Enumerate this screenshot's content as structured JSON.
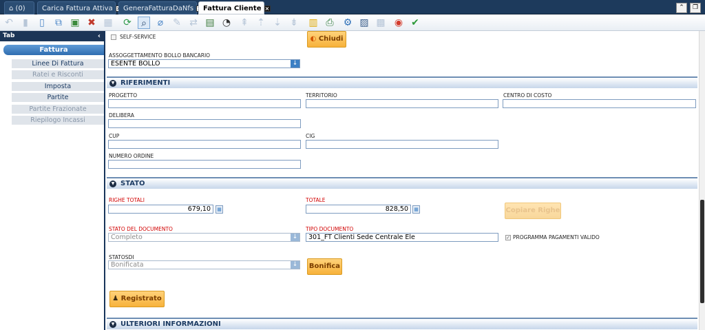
{
  "tabs": [
    {
      "label": "(0)"
    },
    {
      "label": "Carica Fattura Attiva"
    },
    {
      "label": "GeneraFatturaDaNfs"
    },
    {
      "label": "Fattura Cliente"
    }
  ],
  "sidebar": {
    "header": "Tab",
    "active_tab": "Fattura",
    "items": [
      {
        "label": "Linee Di Fattura",
        "enabled": true
      },
      {
        "label": "Ratei e Risconti",
        "enabled": false
      },
      {
        "label": "Imposta",
        "enabled": true
      },
      {
        "label": "Partite",
        "enabled": true
      },
      {
        "label": "Partite Frazionate",
        "enabled": false
      },
      {
        "label": "Riepilogo Incassi",
        "enabled": false
      }
    ]
  },
  "top": {
    "self_service_label": "SELF-SERVICE",
    "chiudi_label": "Chiudi",
    "bollo_label": "ASSOGGETTAMENTO BOLLO BANCARIO",
    "bollo_value": "ESENTE BOLLO"
  },
  "riferimenti": {
    "title": "RIFERIMENTI",
    "progetto_label": "PROGETTO",
    "progetto_value": "",
    "territorio_label": "TERRITORIO",
    "territorio_value": "",
    "centro_label": "CENTRO DI COSTO",
    "centro_value": "",
    "delibera_label": "DELIBERA",
    "delibera_value": "",
    "cup_label": "CUP",
    "cup_value": "",
    "cig_label": "CIG",
    "cig_value": "",
    "numero_ordine_label": "NUMERO ORDINE",
    "numero_ordine_value": ""
  },
  "stato": {
    "title": "STATO",
    "righe_totali_label": "RIGHE TOTALI",
    "righe_totali_value": "679,10",
    "totale_label": "TOTALE",
    "totale_value": "828,50",
    "copiare_righe_label": "Copiare Righe",
    "stato_documento_label": "STATO DEL DOCUMENTO",
    "stato_documento_value": "Completo",
    "tipo_documento_label": "TIPO DOCUMENTO",
    "tipo_documento_value": "301_FT Clienti Sede Centrale Ele",
    "programma_label": "PROGRAMMA PAGAMENTI VALIDO",
    "statosdi_label": "STATOSDI",
    "statosdi_value": "Bonificata",
    "bonifica_label": "Bonifica",
    "registrato_label": "Registrato"
  },
  "ulteriori": {
    "title": "ULTERIORI INFORMAZIONI"
  },
  "icons": {
    "accent": "#2f6db0",
    "button": "#f7b23b",
    "required_label": "#d10000"
  }
}
